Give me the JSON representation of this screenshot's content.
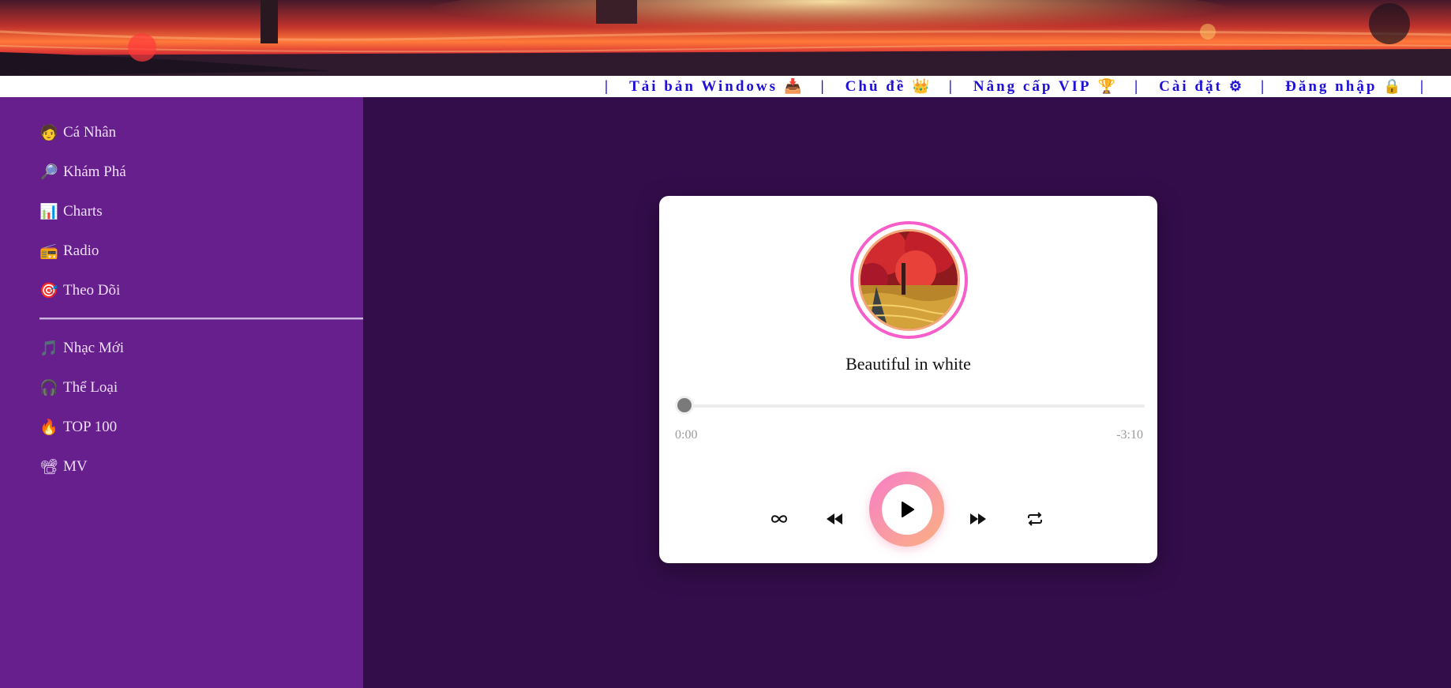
{
  "colors": {
    "sidebar_bg": "#661f8c",
    "main_bg": "#330d4a",
    "nav_text": "#1e10d6",
    "accent_pink": "#f75ec9",
    "accent_peach": "#fbb07f"
  },
  "topnav": {
    "items": [
      {
        "label": "Tải bản Windows",
        "icon": "inbox-tray-icon",
        "glyph": "📥"
      },
      {
        "label": "Chủ đề",
        "icon": "crown-icon",
        "glyph": "👑"
      },
      {
        "label": "Nâng cấp VIP",
        "icon": "trophy-icon",
        "glyph": "🏆"
      },
      {
        "label": "Cài đặt",
        "icon": "gear-icon",
        "glyph": "⚙"
      },
      {
        "label": "Đăng nhập",
        "icon": "lock-icon",
        "glyph": "🔒"
      }
    ],
    "separator": "|"
  },
  "sidebar": {
    "items": [
      {
        "label": "Cá Nhân",
        "icon": "person-icon",
        "glyph": "🧑"
      },
      {
        "label": "Khám Phá",
        "icon": "magnifier-icon",
        "glyph": "🔎"
      },
      {
        "label": "Charts",
        "icon": "bar-chart-icon",
        "glyph": "📊"
      },
      {
        "label": "Radio",
        "icon": "radio-icon",
        "glyph": "📻"
      },
      {
        "label": "Theo Dõi",
        "icon": "target-icon",
        "glyph": "🎯"
      }
    ],
    "items2": [
      {
        "label": "Nhạc Mới",
        "icon": "music-note-icon",
        "glyph": "🎵"
      },
      {
        "label": "Thể Loại",
        "icon": "headphones-icon",
        "glyph": "🎧"
      },
      {
        "label": "TOP 100",
        "icon": "fire-icon",
        "glyph": "🔥"
      },
      {
        "label": "MV",
        "icon": "film-projector-icon",
        "glyph": "📽"
      }
    ]
  },
  "player": {
    "song_title": "Beautiful in white",
    "current_time": "0:00",
    "remaining_time": "-3:10",
    "progress": 0,
    "controls": [
      "infinity-icon",
      "rewind-icon",
      "play-icon",
      "fast-forward-icon",
      "repeat-icon"
    ]
  }
}
